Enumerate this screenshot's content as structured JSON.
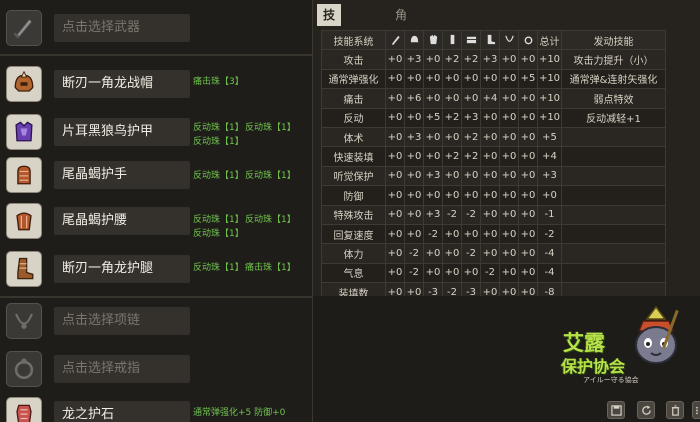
{
  "equipment": [
    {
      "name": "点击选择武器",
      "placeholder": true,
      "icon": "sword-icon",
      "skills": []
    },
    {
      "name": "断刃一角龙战帽",
      "placeholder": false,
      "icon": "helmet-icon",
      "skills": [
        "痛击珠【3】"
      ]
    },
    {
      "name": "片耳黑狼鸟护甲",
      "placeholder": false,
      "icon": "chest-armor-icon",
      "skills": [
        "反动珠【1】",
        "反动珠【1】",
        "反动珠【1】"
      ]
    },
    {
      "name": "尾晶蝎护手",
      "placeholder": false,
      "icon": "gauntlet-icon",
      "skills": [
        "反动珠【1】",
        "反动珠【1】"
      ]
    },
    {
      "name": "尾晶蝎护腰",
      "placeholder": false,
      "icon": "waist-icon",
      "skills": [
        "反动珠【1】",
        "反动珠【1】",
        "反动珠【1】"
      ]
    },
    {
      "name": "断刃一角龙护腿",
      "placeholder": false,
      "icon": "boots-icon",
      "skills": [
        "反动珠【1】",
        "痛击珠【1】"
      ]
    },
    {
      "name": "点击选择项链",
      "placeholder": true,
      "icon": "necklace-icon",
      "skills": []
    },
    {
      "name": "点击选择戒指",
      "placeholder": true,
      "icon": "ring-icon",
      "skills": []
    },
    {
      "name": "龙之护石",
      "placeholder": false,
      "icon": "charm-icon",
      "skills": [
        "通常弹强化+5 防御+0"
      ]
    }
  ],
  "tabs": [
    {
      "label": "技能详情",
      "active": true
    },
    {
      "label": "角色信息",
      "active": false
    }
  ],
  "table": {
    "col_skill": "技能系统",
    "col_icons": [
      "sword-icon",
      "helmet-icon",
      "chest-armor-icon",
      "gauntlet-icon",
      "waist-icon",
      "boots-icon",
      "necklace-icon",
      "ring-icon"
    ],
    "col_total": "总计",
    "col_trigger": "发动技能",
    "rows": [
      {
        "skill": "攻击",
        "vals": [
          "+0",
          "+3",
          "+0",
          "+2",
          "+2",
          "+3",
          "+0",
          "+0"
        ],
        "total": "+10",
        "trigger": "攻击力提升（小）"
      },
      {
        "skill": "通常弹强化",
        "vals": [
          "+0",
          "+0",
          "+0",
          "+0",
          "+0",
          "+0",
          "+0",
          "+5"
        ],
        "total": "+10",
        "trigger": "通常弹&连射矢强化"
      },
      {
        "skill": "痛击",
        "vals": [
          "+0",
          "+6",
          "+0",
          "+0",
          "+0",
          "+4",
          "+0",
          "+0"
        ],
        "total": "+10",
        "trigger": "弱点特效"
      },
      {
        "skill": "反动",
        "vals": [
          "+0",
          "+0",
          "+5",
          "+2",
          "+3",
          "+0",
          "+0",
          "+0"
        ],
        "total": "+10",
        "trigger": "反动减轻+1"
      },
      {
        "skill": "体术",
        "vals": [
          "+0",
          "+3",
          "+0",
          "+0",
          "+2",
          "+0",
          "+0",
          "+0"
        ],
        "total": "+5",
        "trigger": ""
      },
      {
        "skill": "快速装填",
        "vals": [
          "+0",
          "+0",
          "+0",
          "+2",
          "+2",
          "+0",
          "+0",
          "+0"
        ],
        "total": "+4",
        "trigger": ""
      },
      {
        "skill": "听觉保护",
        "vals": [
          "+0",
          "+0",
          "+3",
          "+0",
          "+0",
          "+0",
          "+0",
          "+0"
        ],
        "total": "+3",
        "trigger": ""
      },
      {
        "skill": "防御",
        "vals": [
          "+0",
          "+0",
          "+0",
          "+0",
          "+0",
          "+0",
          "+0",
          "+0"
        ],
        "total": "+0",
        "trigger": ""
      },
      {
        "skill": "特殊攻击",
        "vals": [
          "+0",
          "+0",
          "+3",
          "-2",
          "-2",
          "+0",
          "+0",
          "+0"
        ],
        "total": "-1",
        "trigger": ""
      },
      {
        "skill": "回复速度",
        "vals": [
          "+0",
          "+0",
          "-2",
          "+0",
          "+0",
          "+0",
          "+0",
          "+0"
        ],
        "total": "-2",
        "trigger": ""
      },
      {
        "skill": "体力",
        "vals": [
          "+0",
          "-2",
          "+0",
          "+0",
          "-2",
          "+0",
          "+0",
          "+0"
        ],
        "total": "-4",
        "trigger": ""
      },
      {
        "skill": "气息",
        "vals": [
          "+0",
          "-2",
          "+0",
          "+0",
          "+0",
          "-2",
          "+0",
          "+0"
        ],
        "total": "-4",
        "trigger": ""
      },
      {
        "skill": "装填数",
        "vals": [
          "+0",
          "+0",
          "-3",
          "-2",
          "-3",
          "+0",
          "+0",
          "+0"
        ],
        "total": "-8",
        "trigger": ""
      }
    ]
  },
  "logo": {
    "line1": "艾露",
    "line2": "保护协会",
    "sub": "アイルー守る協会"
  },
  "toolbar": [
    "save-icon",
    "refresh-icon",
    "trash-icon",
    "more-icon"
  ],
  "colors": {
    "skill_text": "#6fc34d",
    "tab_active": "#d9d4c8",
    "logo_green": "#b7e04a"
  }
}
